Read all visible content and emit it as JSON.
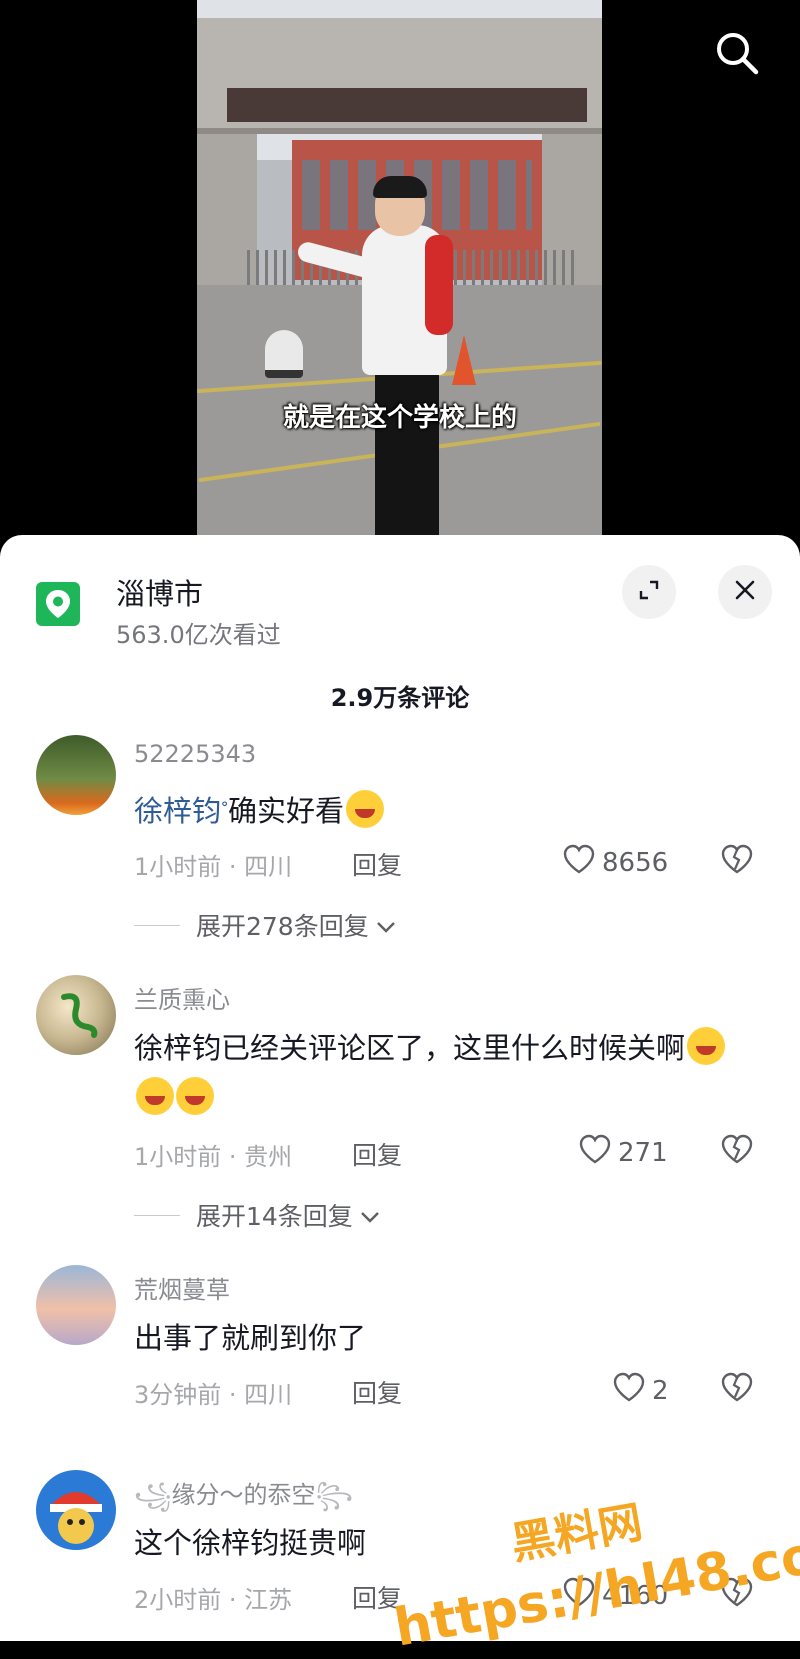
{
  "video": {
    "subtitle": "就是在这个学校上的"
  },
  "panel": {
    "location_title": "淄博市",
    "location_views": "563.0亿次看过",
    "comment_count": "2.9万条评论"
  },
  "comments": [
    {
      "username": "52225343",
      "mention": "徐梓钧",
      "text": "确实好看",
      "meta": "1小时前 · 四川",
      "reply_label": "回复",
      "likes": "8656",
      "expand_label": "展开278条回复"
    },
    {
      "username": "兰质熏心",
      "text": "徐梓钧已经关评论区了，这里什么时候关啊",
      "meta": "1小时前 · 贵州",
      "reply_label": "回复",
      "likes": "271",
      "expand_label": "展开14条回复"
    },
    {
      "username": "荒烟蔓草",
      "text": "出事了就刷到你了",
      "meta": "3分钟前 · 四川",
      "reply_label": "回复",
      "likes": "2"
    },
    {
      "username": "缘分～的忝空",
      "text": "这个徐梓钧挺贵啊",
      "meta": "2小时前 · 江苏",
      "reply_label": "回复",
      "likes": "4160"
    }
  ],
  "watermark": {
    "line1": "黑料网",
    "line2": "https://hl48.co"
  },
  "colors": {
    "location_green": "#1fb65a",
    "mention_blue": "#2f5c96",
    "watermark_orange": "#f5a623"
  },
  "icons": [
    "search-icon",
    "location-pin-icon",
    "expand-icon",
    "close-icon",
    "heart-icon",
    "broken-heart-icon",
    "chevron-down-icon"
  ]
}
